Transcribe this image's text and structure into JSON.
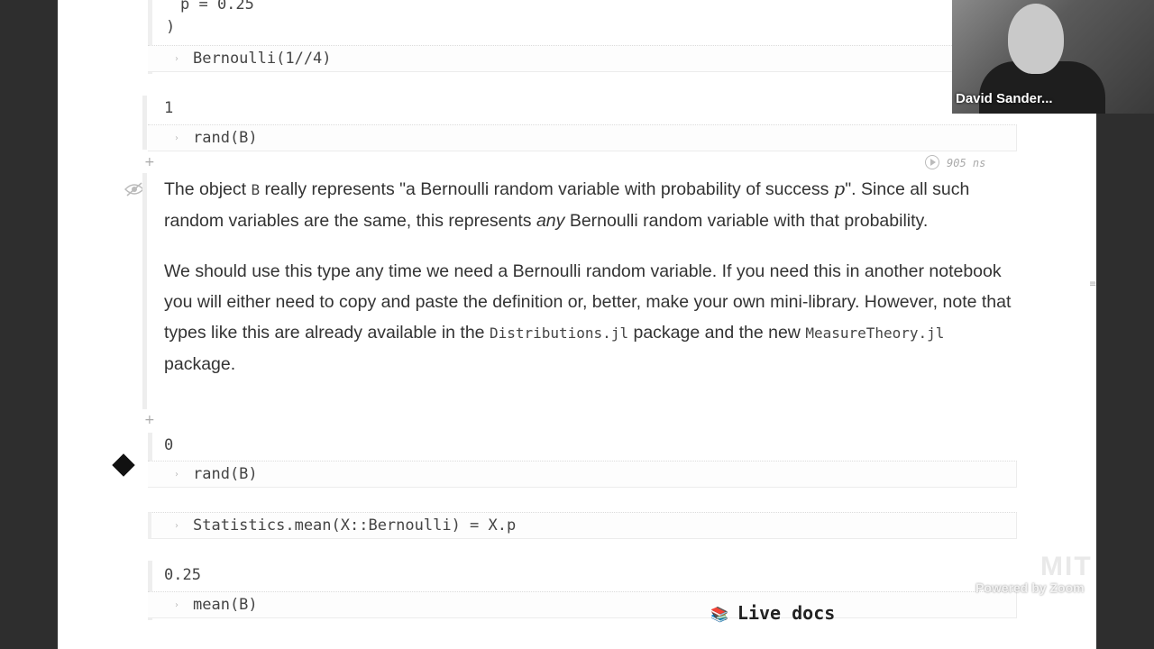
{
  "cells": {
    "top_partial": {
      "code_line1": "p = 0.25",
      "code_line2": ")",
      "code_input": "Bernoulli(1//4)"
    },
    "rand_cell_1": {
      "output": "1",
      "code": "rand(B)"
    },
    "runtime": "905 ns",
    "markdown": {
      "p1_a": "The object ",
      "p1_code": "B",
      "p1_b": " really represents \"a Bernoulli random variable with probability of success ",
      "p1_var": "p",
      "p1_c": "\". Since all such random variables are the same, this represents ",
      "p1_em": "any",
      "p1_d": " Bernoulli random variable with that probability.",
      "p2_a": "We should use this type any time we need a Bernoulli random variable. If you need this in another notebook you will either need to copy and paste the definition or, better, make your own mini-library. However, note that types like this are already available in the ",
      "p2_code1": "Distributions.jl",
      "p2_b": " package and the new ",
      "p2_code2": "MeasureTheory.jl",
      "p2_c": " package."
    },
    "rand_cell_2": {
      "output": "0",
      "code": "rand(B)"
    },
    "mean_def_cell": {
      "code": "Statistics.mean(X::Bernoulli) = X.p"
    },
    "mean_cell": {
      "output": "0.25",
      "code": "mean(B)"
    }
  },
  "webcam": {
    "name": "David Sander..."
  },
  "live_docs": {
    "label": "Live docs",
    "icon": "book-icon"
  },
  "watermark": {
    "logo": "MIT",
    "powered": "Powered by Zoom"
  },
  "colors": {
    "notebook_bg": "#ffffff",
    "sidebar_bg": "#2e2e2e",
    "text": "#333333"
  }
}
